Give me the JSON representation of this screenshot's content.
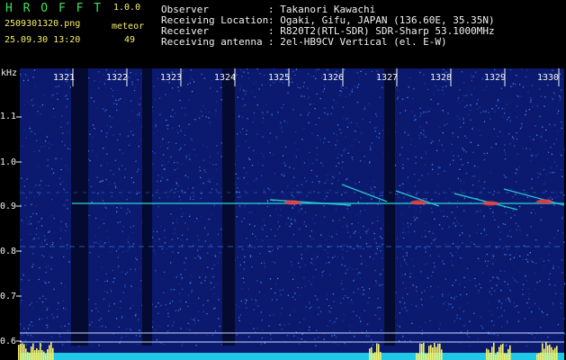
{
  "header": {
    "app_title": "H R O F F T",
    "version": "1.0.0",
    "filename": "2509301320.png",
    "datetime": "25.09.30 13:20",
    "count_label": "meteor",
    "count_value": "49",
    "info": [
      {
        "label": "Observer",
        "value": ": Takanori Kawachi"
      },
      {
        "label": "Receiving Location",
        "value": ": Ogaki, Gifu, JAPAN (136.60E, 35.35N)"
      },
      {
        "label": "Receiver",
        "value": ": R820T2(RTL-SDR) SDR-Sharp 53.1000MHz"
      },
      {
        "label": "Receiving antenna",
        "value": ": 2el-HB9CV Vertical (el. E-W)"
      }
    ]
  },
  "spectrogram": {
    "y_unit": "kHz",
    "y_ticks": [
      "1.1",
      "1.0",
      "0.9",
      "0.8",
      "0.7",
      "0.6"
    ],
    "x_ticks": [
      "1321",
      "1322",
      "1323",
      "1324",
      "1325",
      "1326",
      "1327",
      "1328",
      "1329",
      "1330"
    ],
    "colors": {
      "background": "#0b1a6e",
      "carrier": "#2ad4d4",
      "meteor_hot": "#f04040",
      "level_bar": "#f5f06a",
      "level_base": "#20c8e8"
    }
  }
}
